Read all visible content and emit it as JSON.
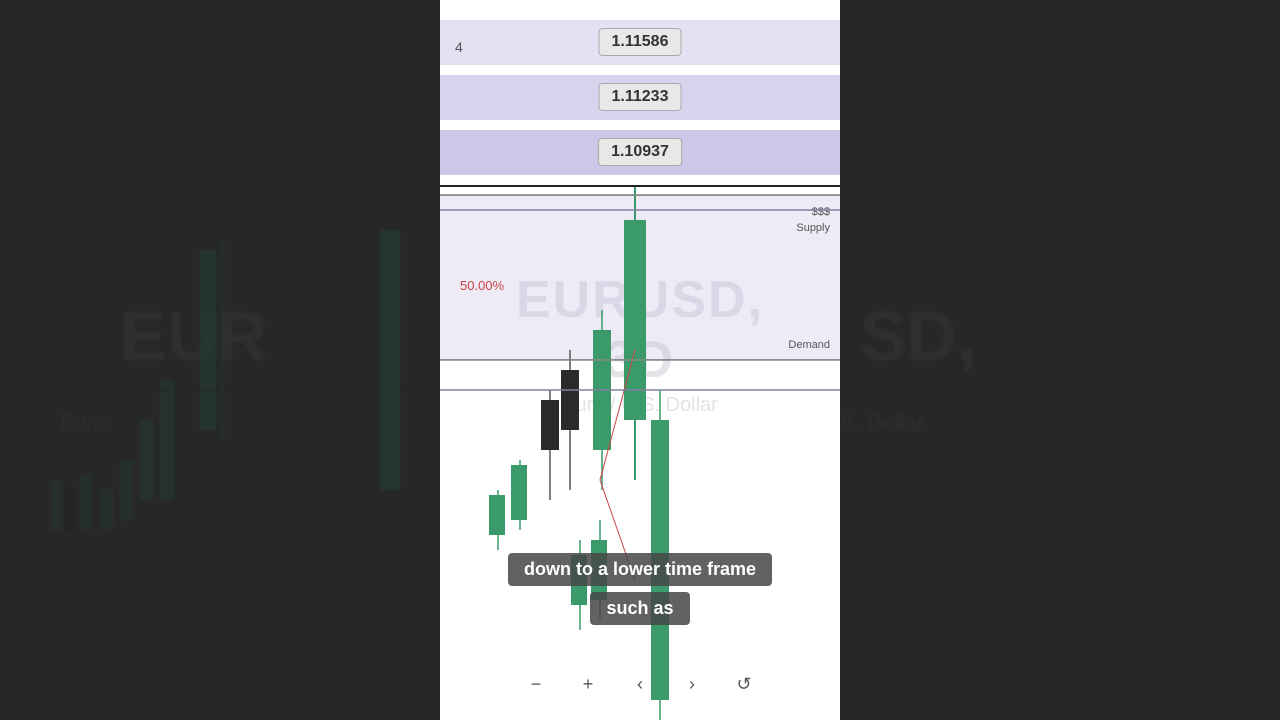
{
  "chart": {
    "symbol": "EURUSD",
    "timeframe": "3D",
    "full_name": "Euro / U.S. Dollar",
    "price_levels": [
      {
        "value": "1.11586"
      },
      {
        "value": "1.11233"
      },
      {
        "value": "1.10937"
      }
    ],
    "zones": {
      "supply_label": "Supply",
      "demand_label": "Demand",
      "sss_label": "$$$",
      "percent_label": "50.00%"
    }
  },
  "caption": {
    "line1": "down to a lower time frame",
    "line2": "such as"
  },
  "toolbar": {
    "zoom_out": "−",
    "zoom_in": "+",
    "arrow_left": "‹",
    "arrow_right": "›",
    "refresh": "↺"
  },
  "colors": {
    "supply_zone": "rgba(200,190,230,0.3)",
    "candle_green": "#3a9a6a",
    "candle_dark": "#2a2a2a",
    "price_box_bg": "#e8e8e8",
    "band_purple": "rgba(180,170,220,0.5)"
  }
}
